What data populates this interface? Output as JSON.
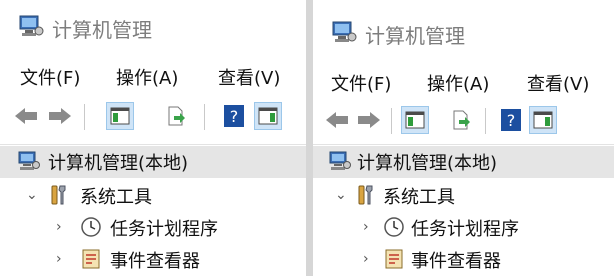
{
  "window": {
    "title": "计算机管理"
  },
  "menu": {
    "items": [
      "文件(F)",
      "操作(A)",
      "查看(V)"
    ]
  },
  "toolbar": {
    "buttons": [
      "back-arrow-icon",
      "forward-arrow-icon",
      "show-console-tree-icon",
      "export-list-icon",
      "help-icon",
      "show-action-pane-icon"
    ]
  },
  "tree": {
    "root": "计算机管理(本地)",
    "system_tools": "系统工具",
    "task_scheduler": "任务计划程序",
    "event_viewer": "事件查看器"
  },
  "colors": {
    "selection": "#e5e5e5",
    "toolbar_active": "#cfe4f7",
    "title_text": "#7d7d7d"
  }
}
